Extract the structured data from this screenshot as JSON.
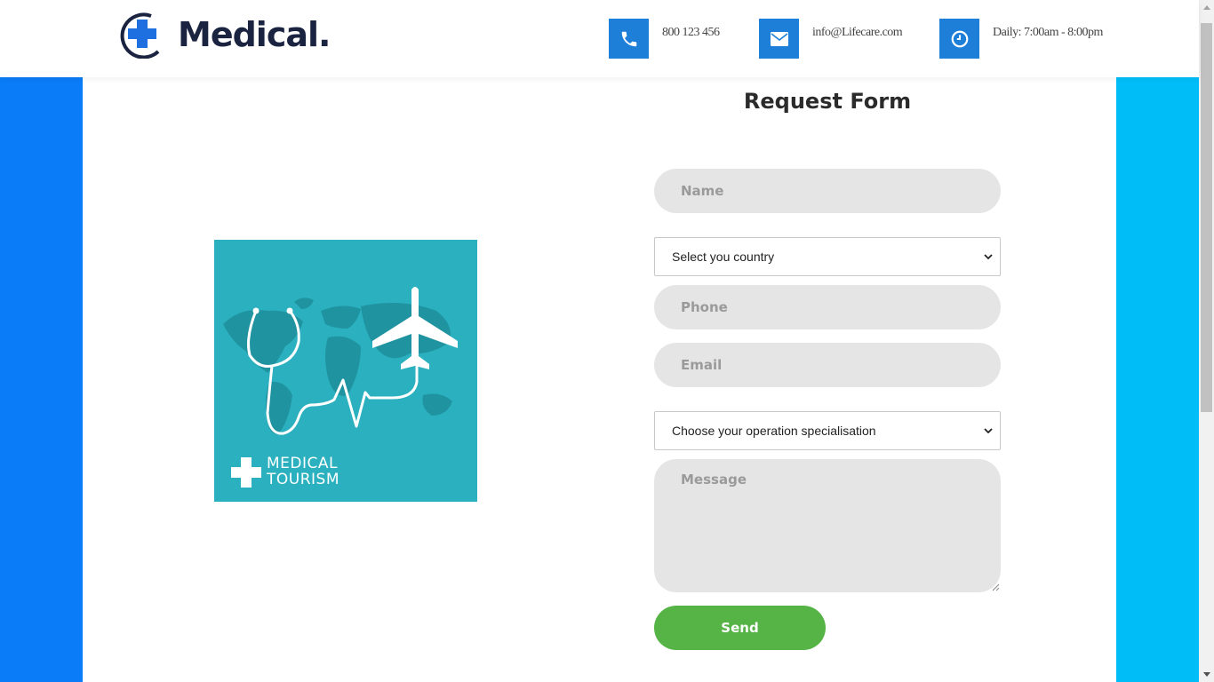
{
  "header": {
    "logo_text": "Medical.",
    "contacts": [
      {
        "icon": "phone-icon",
        "text": "800 123 456"
      },
      {
        "icon": "mail-icon",
        "text": "info@Lifecare.com"
      },
      {
        "icon": "clock-icon",
        "text": "Daily: 7:00am - 8:00pm"
      }
    ]
  },
  "image": {
    "caption_line1": "MEDICAL",
    "caption_line2": "TOURISM"
  },
  "form": {
    "title": "Request Form",
    "name_placeholder": "Name",
    "country_select": "Select you country",
    "phone_placeholder": "Phone",
    "email_placeholder": "Email",
    "specialisation_select": "Choose your operation specialisation",
    "message_placeholder": "Message",
    "send_label": "Send"
  },
  "colors": {
    "accent_blue": "#1e7fd8",
    "strip_left": "#0a7cf7",
    "strip_right": "#00bdf8",
    "send_green": "#56b346",
    "image_teal": "#2ab0bf"
  }
}
